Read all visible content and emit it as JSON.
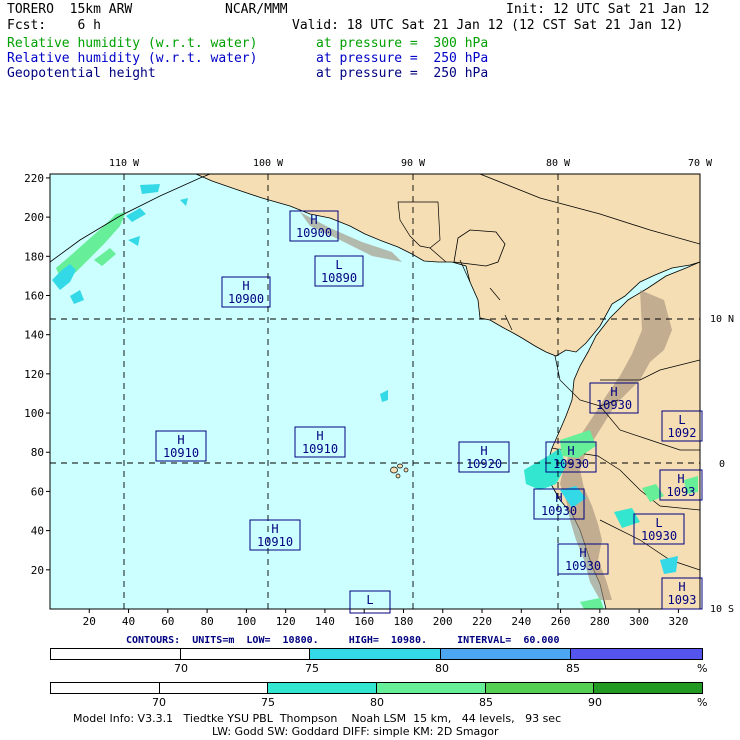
{
  "header": {
    "model": "TORERO  15km ARW",
    "center": "NCAR/MMM",
    "init": "Init: 12 UTC Sat 21 Jan 12",
    "fcst": "Fcst:    6 h",
    "valid": "Valid: 18 UTC Sat 21 Jan 12 (12 CST Sat 21 Jan 12)",
    "fields": [
      {
        "name": "Relative humidity (w.r.t. water)",
        "level": "at pressure =  300 hPa",
        "color": "#00a000"
      },
      {
        "name": "Relative humidity (w.r.t. water)",
        "level": "at pressure =  250 hPa",
        "color": "#0000c8"
      },
      {
        "name": "Geopotential height",
        "level": "at pressure =  250 hPa",
        "color": "#000080"
      }
    ]
  },
  "map": {
    "lon_labels": [
      "110 W",
      "100 W",
      "90 W",
      "80 W",
      "70 W"
    ],
    "lat_labels": [
      "10 N",
      "0",
      "10 S"
    ],
    "y_ticks": [
      "220",
      "200",
      "180",
      "160",
      "140",
      "120",
      "100",
      "80",
      "60",
      "40",
      "20"
    ],
    "x_ticks": [
      "20",
      "40",
      "60",
      "80",
      "100",
      "120",
      "140",
      "160",
      "180",
      "200",
      "220",
      "240",
      "260",
      "280",
      "300",
      "320"
    ],
    "colors": {
      "ocean": "#ccffff",
      "land": "#f5deb3",
      "terrain": "#a08c78",
      "contour_box": "#000080"
    },
    "centers": [
      {
        "type": "H",
        "value": "10900"
      },
      {
        "type": "L",
        "value": "10890"
      },
      {
        "type": "H",
        "value": "10900"
      },
      {
        "type": "H",
        "value": "10930"
      },
      {
        "type": "L",
        "value": "1092"
      },
      {
        "type": "H",
        "value": "10910"
      },
      {
        "type": "H",
        "value": "10910"
      },
      {
        "type": "H",
        "value": "10920"
      },
      {
        "type": "H",
        "value": "10930"
      },
      {
        "type": "H",
        "value": "1093"
      },
      {
        "type": "H",
        "value": "10930"
      },
      {
        "type": "L",
        "value": "10930"
      },
      {
        "type": "H",
        "value": "10910"
      },
      {
        "type": "H",
        "value": "10930"
      },
      {
        "type": "L",
        "value": ""
      },
      {
        "type": "H",
        "value": "1093"
      }
    ]
  },
  "contours_line": "CONTOURS:  UNITS=m  LOW=  10800.     HIGH=  10980.     INTERVAL=  60.000",
  "colorbar1": {
    "labels": [
      "70",
      "75",
      "80",
      "85",
      "%"
    ],
    "colors": [
      "#ffffff",
      "#ffffff",
      "#33d9e6",
      "#4da6f2",
      "#5555ee"
    ]
  },
  "colorbar2": {
    "labels": [
      "70",
      "75",
      "80",
      "85",
      "90",
      "%"
    ],
    "colors": [
      "#ffffff",
      "#ffffff",
      "#33e6d0",
      "#66ee99",
      "#55d055",
      "#229922"
    ]
  },
  "footer": {
    "line1": "Model Info: V3.3.1   Tiedtke YSU PBL  Thompson    Noah LSM  15 km,   44 levels,   93 sec",
    "line2": "LW: Godd SW: Goddard DIFF: simple KM: 2D Smagor"
  }
}
